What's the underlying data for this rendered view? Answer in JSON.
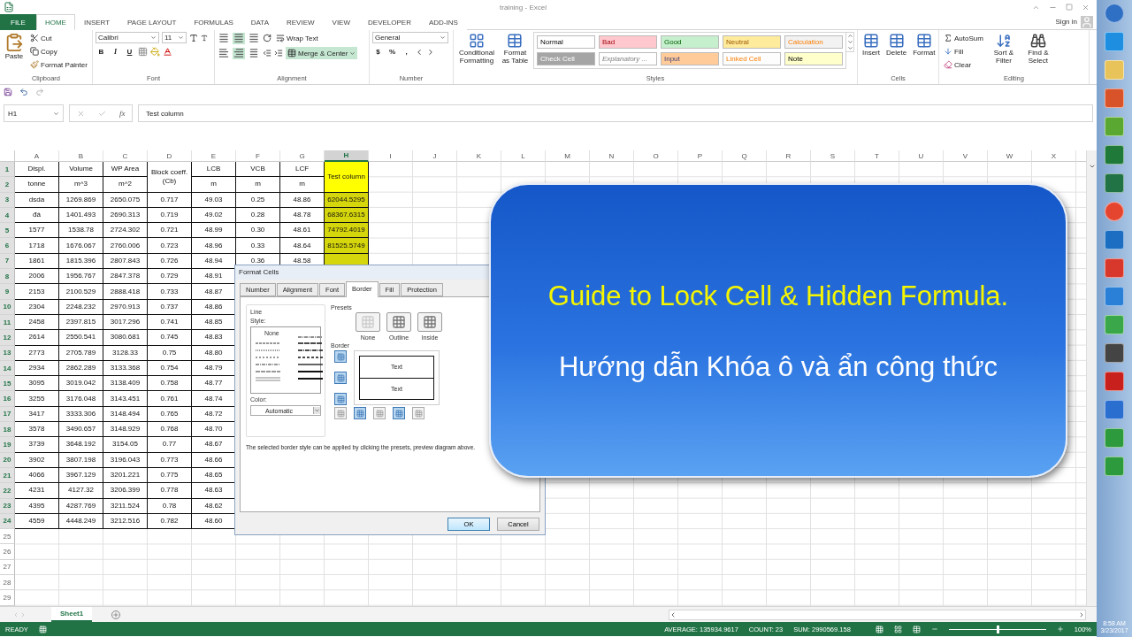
{
  "window": {
    "title": "training - Excel",
    "sign_in": "Sign in"
  },
  "tabs": [
    {
      "label": "FILE",
      "kind": "file",
      "selected": false
    },
    {
      "label": "HOME",
      "kind": "tab",
      "selected": true
    },
    {
      "label": "INSERT",
      "kind": "tab",
      "selected": false
    },
    {
      "label": "PAGE LAYOUT",
      "kind": "tab",
      "selected": false
    },
    {
      "label": "FORMULAS",
      "kind": "tab",
      "selected": false
    },
    {
      "label": "DATA",
      "kind": "tab",
      "selected": false
    },
    {
      "label": "REVIEW",
      "kind": "tab",
      "selected": false
    },
    {
      "label": "VIEW",
      "kind": "tab",
      "selected": false
    },
    {
      "label": "DEVELOPER",
      "kind": "tab",
      "selected": false
    },
    {
      "label": "ADD-INS",
      "kind": "tab",
      "selected": false
    }
  ],
  "ribbon": {
    "clipboard": {
      "paste": "Paste",
      "cut": "Cut",
      "copy": "Copy",
      "format_painter": "Format Painter",
      "label": "Clipboard"
    },
    "font": {
      "name": "Calibri",
      "size": "11",
      "bold": "B",
      "italic": "I",
      "underline": "U",
      "label": "Font"
    },
    "alignment": {
      "vertical": [
        {
          "selected": false
        },
        {
          "selected": true
        },
        {
          "selected": false
        }
      ],
      "horizontal": [
        {
          "selected": false
        },
        {
          "selected": true
        },
        {
          "selected": false
        }
      ],
      "wrap_text": "Wrap Text",
      "merge_center": "Merge & Center",
      "merge_selected": true,
      "label": "Alignment"
    },
    "number": {
      "format": "General",
      "currency": "$",
      "percent": "%",
      "comma": ",",
      "label": "Number"
    },
    "conditional_formatting": "Conditional Formatting",
    "format_as_table": "Format as Table",
    "styles": [
      {
        "label": "Normal",
        "color": "#ffffff"
      },
      {
        "label": "Bad",
        "color": "#ffc7ce"
      },
      {
        "label": "Good",
        "color": "#c6efce"
      },
      {
        "label": "Neutral",
        "color": "#ffeb9c"
      },
      {
        "label": "Calculation",
        "color": "#f2f2f2"
      },
      {
        "label": "Check Cell",
        "color": "#a5a5a5"
      },
      {
        "label": "Explanatory ...",
        "color": "#fefefe"
      },
      {
        "label": "Input",
        "color": "#ffcc99"
      },
      {
        "label": "Linked Cell",
        "color": "#fdfdfd"
      },
      {
        "label": "Note",
        "color": "#ffffcc"
      }
    ],
    "styles_label": "Styles",
    "cells": [
      {
        "label": "Insert"
      },
      {
        "label": "Delete"
      },
      {
        "label": "Format"
      }
    ],
    "cells_label": "Cells",
    "editing": {
      "autosum": "AutoSum",
      "fill": "Fill",
      "clear": "Clear",
      "sort_filter": "Sort & Filter",
      "find_select": "Find & Select",
      "label": "Editing"
    }
  },
  "formula_bar": {
    "name_box": "H1",
    "function_label": "fx",
    "value": "Test column"
  },
  "sheet": {
    "columns": [
      {
        "label": "A",
        "selected": false
      },
      {
        "label": "B",
        "selected": false
      },
      {
        "label": "C",
        "selected": false
      },
      {
        "label": "D",
        "selected": false
      },
      {
        "label": "E",
        "selected": false
      },
      {
        "label": "F",
        "selected": false
      },
      {
        "label": "G",
        "selected": false
      },
      {
        "label": "H",
        "selected": true
      },
      {
        "label": "I",
        "selected": false
      },
      {
        "label": "J",
        "selected": false
      },
      {
        "label": "K",
        "selected": false
      },
      {
        "label": "L",
        "selected": false
      },
      {
        "label": "M",
        "selected": false
      },
      {
        "label": "N",
        "selected": false
      },
      {
        "label": "O",
        "selected": false
      },
      {
        "label": "P",
        "selected": false
      },
      {
        "label": "Q",
        "selected": false
      },
      {
        "label": "R",
        "selected": false
      },
      {
        "label": "S",
        "selected": false
      },
      {
        "label": "T",
        "selected": false
      },
      {
        "label": "U",
        "selected": false
      },
      {
        "label": "V",
        "selected": false
      },
      {
        "label": "W",
        "selected": false
      },
      {
        "label": "X",
        "selected": false
      }
    ],
    "rows": [
      {
        "number": "1",
        "highlighted": true,
        "cells": [
          {
            "text": "Displ."
          },
          {
            "text": "Volume"
          },
          {
            "text": "WP Area"
          },
          {
            "text": "Block coeff.(Cb)",
            "kind": "merged"
          },
          {
            "text": "LCB"
          },
          {
            "text": "VCB"
          },
          {
            "text": "LCF"
          },
          {
            "text": "Test column",
            "kind": "merged",
            "color": "#ffff00"
          }
        ]
      },
      {
        "number": "2",
        "highlighted": true,
        "cells": [
          {
            "text": "tonne"
          },
          {
            "text": "m^3"
          },
          {
            "text": "m^2"
          },
          {
            "text": ""
          },
          {
            "text": "m"
          },
          {
            "text": "m"
          },
          {
            "text": "m"
          }
        ]
      },
      {
        "number": "3",
        "highlighted": true,
        "cells": [
          {
            "text": "dsda"
          },
          {
            "text": "1269.869"
          },
          {
            "text": "2650.075"
          },
          {
            "text": "0.717"
          },
          {
            "text": "49.03"
          },
          {
            "text": "0.25"
          },
          {
            "text": "48.86"
          },
          {
            "text": "62044.5295",
            "color": "#d6d60c"
          }
        ]
      },
      {
        "number": "4",
        "highlighted": true,
        "cells": [
          {
            "text": "đá"
          },
          {
            "text": "1401.493"
          },
          {
            "text": "2690.313"
          },
          {
            "text": "0.719"
          },
          {
            "text": "49.02"
          },
          {
            "text": "0.28"
          },
          {
            "text": "48.78"
          },
          {
            "text": "68367.6315",
            "color": "#d6d60c"
          }
        ]
      },
      {
        "number": "5",
        "highlighted": true,
        "cells": [
          {
            "text": "1577"
          },
          {
            "text": "1538.78"
          },
          {
            "text": "2724.302"
          },
          {
            "text": "0.721"
          },
          {
            "text": "48.99"
          },
          {
            "text": "0.30"
          },
          {
            "text": "48.61"
          },
          {
            "text": "74792.4019",
            "color": "#d6d60c"
          }
        ]
      },
      {
        "number": "6",
        "highlighted": true,
        "cells": [
          {
            "text": "1718"
          },
          {
            "text": "1676.067"
          },
          {
            "text": "2760.006"
          },
          {
            "text": "0.723"
          },
          {
            "text": "48.96"
          },
          {
            "text": "0.33"
          },
          {
            "text": "48.64"
          },
          {
            "text": "81525.5749",
            "color": "#d6d60c"
          }
        ]
      },
      {
        "number": "7",
        "highlighted": true,
        "cells": [
          {
            "text": "1861"
          },
          {
            "text": "1815.396"
          },
          {
            "text": "2807.843"
          },
          {
            "text": "0.726"
          },
          {
            "text": "48.94"
          },
          {
            "text": "0.36"
          },
          {
            "text": "48.58"
          },
          {
            "color": "#d6d60c"
          }
        ]
      },
      {
        "number": "8",
        "highlighted": true,
        "cells": [
          {
            "text": "2006"
          },
          {
            "text": "1956.767"
          },
          {
            "text": "2847.378"
          },
          {
            "text": "0.729"
          },
          {
            "text": "48.91"
          }
        ]
      },
      {
        "number": "9",
        "highlighted": true,
        "cells": [
          {
            "text": "2153"
          },
          {
            "text": "2100.529"
          },
          {
            "text": "2888.418"
          },
          {
            "text": "0.733"
          },
          {
            "text": "48.87"
          }
        ]
      },
      {
        "number": "10",
        "highlighted": true,
        "cells": [
          {
            "text": "2304"
          },
          {
            "text": "2248.232"
          },
          {
            "text": "2970.913"
          },
          {
            "text": "0.737"
          },
          {
            "text": "48.86"
          }
        ]
      },
      {
        "number": "11",
        "highlighted": true,
        "cells": [
          {
            "text": "2458"
          },
          {
            "text": "2397.815"
          },
          {
            "text": "3017.296"
          },
          {
            "text": "0.741"
          },
          {
            "text": "48.85"
          }
        ]
      },
      {
        "number": "12",
        "highlighted": true,
        "cells": [
          {
            "text": "2614"
          },
          {
            "text": "2550.541"
          },
          {
            "text": "3080.681"
          },
          {
            "text": "0.745"
          },
          {
            "text": "48.83"
          }
        ]
      },
      {
        "number": "13",
        "highlighted": true,
        "cells": [
          {
            "text": "2773"
          },
          {
            "text": "2705.789"
          },
          {
            "text": "3128.33"
          },
          {
            "text": "0.75"
          },
          {
            "text": "48.80"
          }
        ]
      },
      {
        "number": "14",
        "highlighted": true,
        "cells": [
          {
            "text": "2934"
          },
          {
            "text": "2862.289"
          },
          {
            "text": "3133.368"
          },
          {
            "text": "0.754"
          },
          {
            "text": "48.79"
          }
        ]
      },
      {
        "number": "15",
        "highlighted": true,
        "cells": [
          {
            "text": "3095"
          },
          {
            "text": "3019.042"
          },
          {
            "text": "3138.409"
          },
          {
            "text": "0.758"
          },
          {
            "text": "48.77"
          }
        ]
      },
      {
        "number": "16",
        "highlighted": true,
        "cells": [
          {
            "text": "3255"
          },
          {
            "text": "3176.048"
          },
          {
            "text": "3143.451"
          },
          {
            "text": "0.761"
          },
          {
            "text": "48.74"
          }
        ]
      },
      {
        "number": "17",
        "highlighted": true,
        "cells": [
          {
            "text": "3417"
          },
          {
            "text": "3333.306"
          },
          {
            "text": "3148.494"
          },
          {
            "text": "0.765"
          },
          {
            "text": "48.72"
          }
        ]
      },
      {
        "number": "18",
        "highlighted": true,
        "cells": [
          {
            "text": "3578"
          },
          {
            "text": "3490.657"
          },
          {
            "text": "3148.929"
          },
          {
            "text": "0.768"
          },
          {
            "text": "48.70"
          }
        ]
      },
      {
        "number": "19",
        "highlighted": true,
        "cells": [
          {
            "text": "3739"
          },
          {
            "text": "3648.192"
          },
          {
            "text": "3154.05"
          },
          {
            "text": "0.77"
          },
          {
            "text": "48.67"
          }
        ]
      },
      {
        "number": "20",
        "highlighted": true,
        "cells": [
          {
            "text": "3902"
          },
          {
            "text": "3807.198"
          },
          {
            "text": "3196.043"
          },
          {
            "text": "0.773"
          },
          {
            "text": "48.66"
          }
        ]
      },
      {
        "number": "21",
        "highlighted": true,
        "cells": [
          {
            "text": "4066"
          },
          {
            "text": "3967.129"
          },
          {
            "text": "3201.221"
          },
          {
            "text": "0.775"
          },
          {
            "text": "48.65"
          }
        ]
      },
      {
        "number": "22",
        "highlighted": true,
        "cells": [
          {
            "text": "4231"
          },
          {
            "text": "4127.32"
          },
          {
            "text": "3206.399"
          },
          {
            "text": "0.778"
          },
          {
            "text": "48.63"
          }
        ]
      },
      {
        "number": "23",
        "highlighted": true,
        "cells": [
          {
            "text": "4395"
          },
          {
            "text": "4287.769"
          },
          {
            "text": "3211.524"
          },
          {
            "text": "0.78"
          },
          {
            "text": "48.62"
          }
        ]
      },
      {
        "number": "24",
        "highlighted": true,
        "cells": [
          {
            "text": "4559"
          },
          {
            "text": "4448.249"
          },
          {
            "text": "3212.516"
          },
          {
            "text": "0.782"
          },
          {
            "text": "48.60"
          }
        ]
      },
      {
        "number": "25",
        "highlighted": false,
        "cells": []
      },
      {
        "number": "26",
        "highlighted": false,
        "cells": []
      },
      {
        "number": "27",
        "highlighted": false,
        "cells": []
      },
      {
        "number": "28",
        "highlighted": false,
        "cells": []
      },
      {
        "number": "29",
        "highlighted": false,
        "cells": []
      }
    ],
    "tabs": [
      {
        "label": "Sheet1",
        "selected": true
      }
    ]
  },
  "status_bar": {
    "mode": "READY",
    "average": "AVERAGE: 135934.9617",
    "count": "COUNT: 23",
    "sum": "SUM: 2990569.158",
    "zoom": "100%",
    "zoom_slider": {
      "level": 0.5
    }
  },
  "dialog": {
    "title": "Format Cells",
    "tabs": [
      {
        "label": "Number",
        "selected": false
      },
      {
        "label": "Alignment",
        "selected": false
      },
      {
        "label": "Font",
        "selected": false
      },
      {
        "label": "Border",
        "selected": true
      },
      {
        "label": "Fill",
        "selected": false
      },
      {
        "label": "Protection",
        "selected": false
      }
    ],
    "line_group": "Line",
    "style_label": "Style:",
    "none_style": "None",
    "color_label": "Color:",
    "color_value": "Automatic",
    "presets_label": "Presets",
    "presets": [
      {
        "label": "None"
      },
      {
        "label": "Outline"
      },
      {
        "label": "Inside"
      }
    ],
    "border_label": "Border",
    "side_toggles": [
      {
        "selected": true
      },
      {
        "selected": true
      },
      {
        "selected": true
      }
    ],
    "bottom_toggles": [
      {
        "selected": false
      },
      {
        "selected": true
      },
      {
        "selected": false
      },
      {
        "selected": true
      },
      {
        "selected": false
      }
    ],
    "preview_texts": [
      "Text",
      "Text"
    ],
    "hint": "The selected border style can be applied by clicking the presets, preview diagram above.",
    "buttons": [
      {
        "label": "OK",
        "kind": "default"
      },
      {
        "label": "Cancel",
        "kind": "normal"
      }
    ]
  },
  "banner": {
    "title": "Guide to Lock Cell & Hidden Formula.",
    "subtitle": "Hướng dẫn Khóa ô và ẩn công thức"
  },
  "taskbar": {
    "time": "8:58 AM",
    "date": "3/23/2017"
  }
}
